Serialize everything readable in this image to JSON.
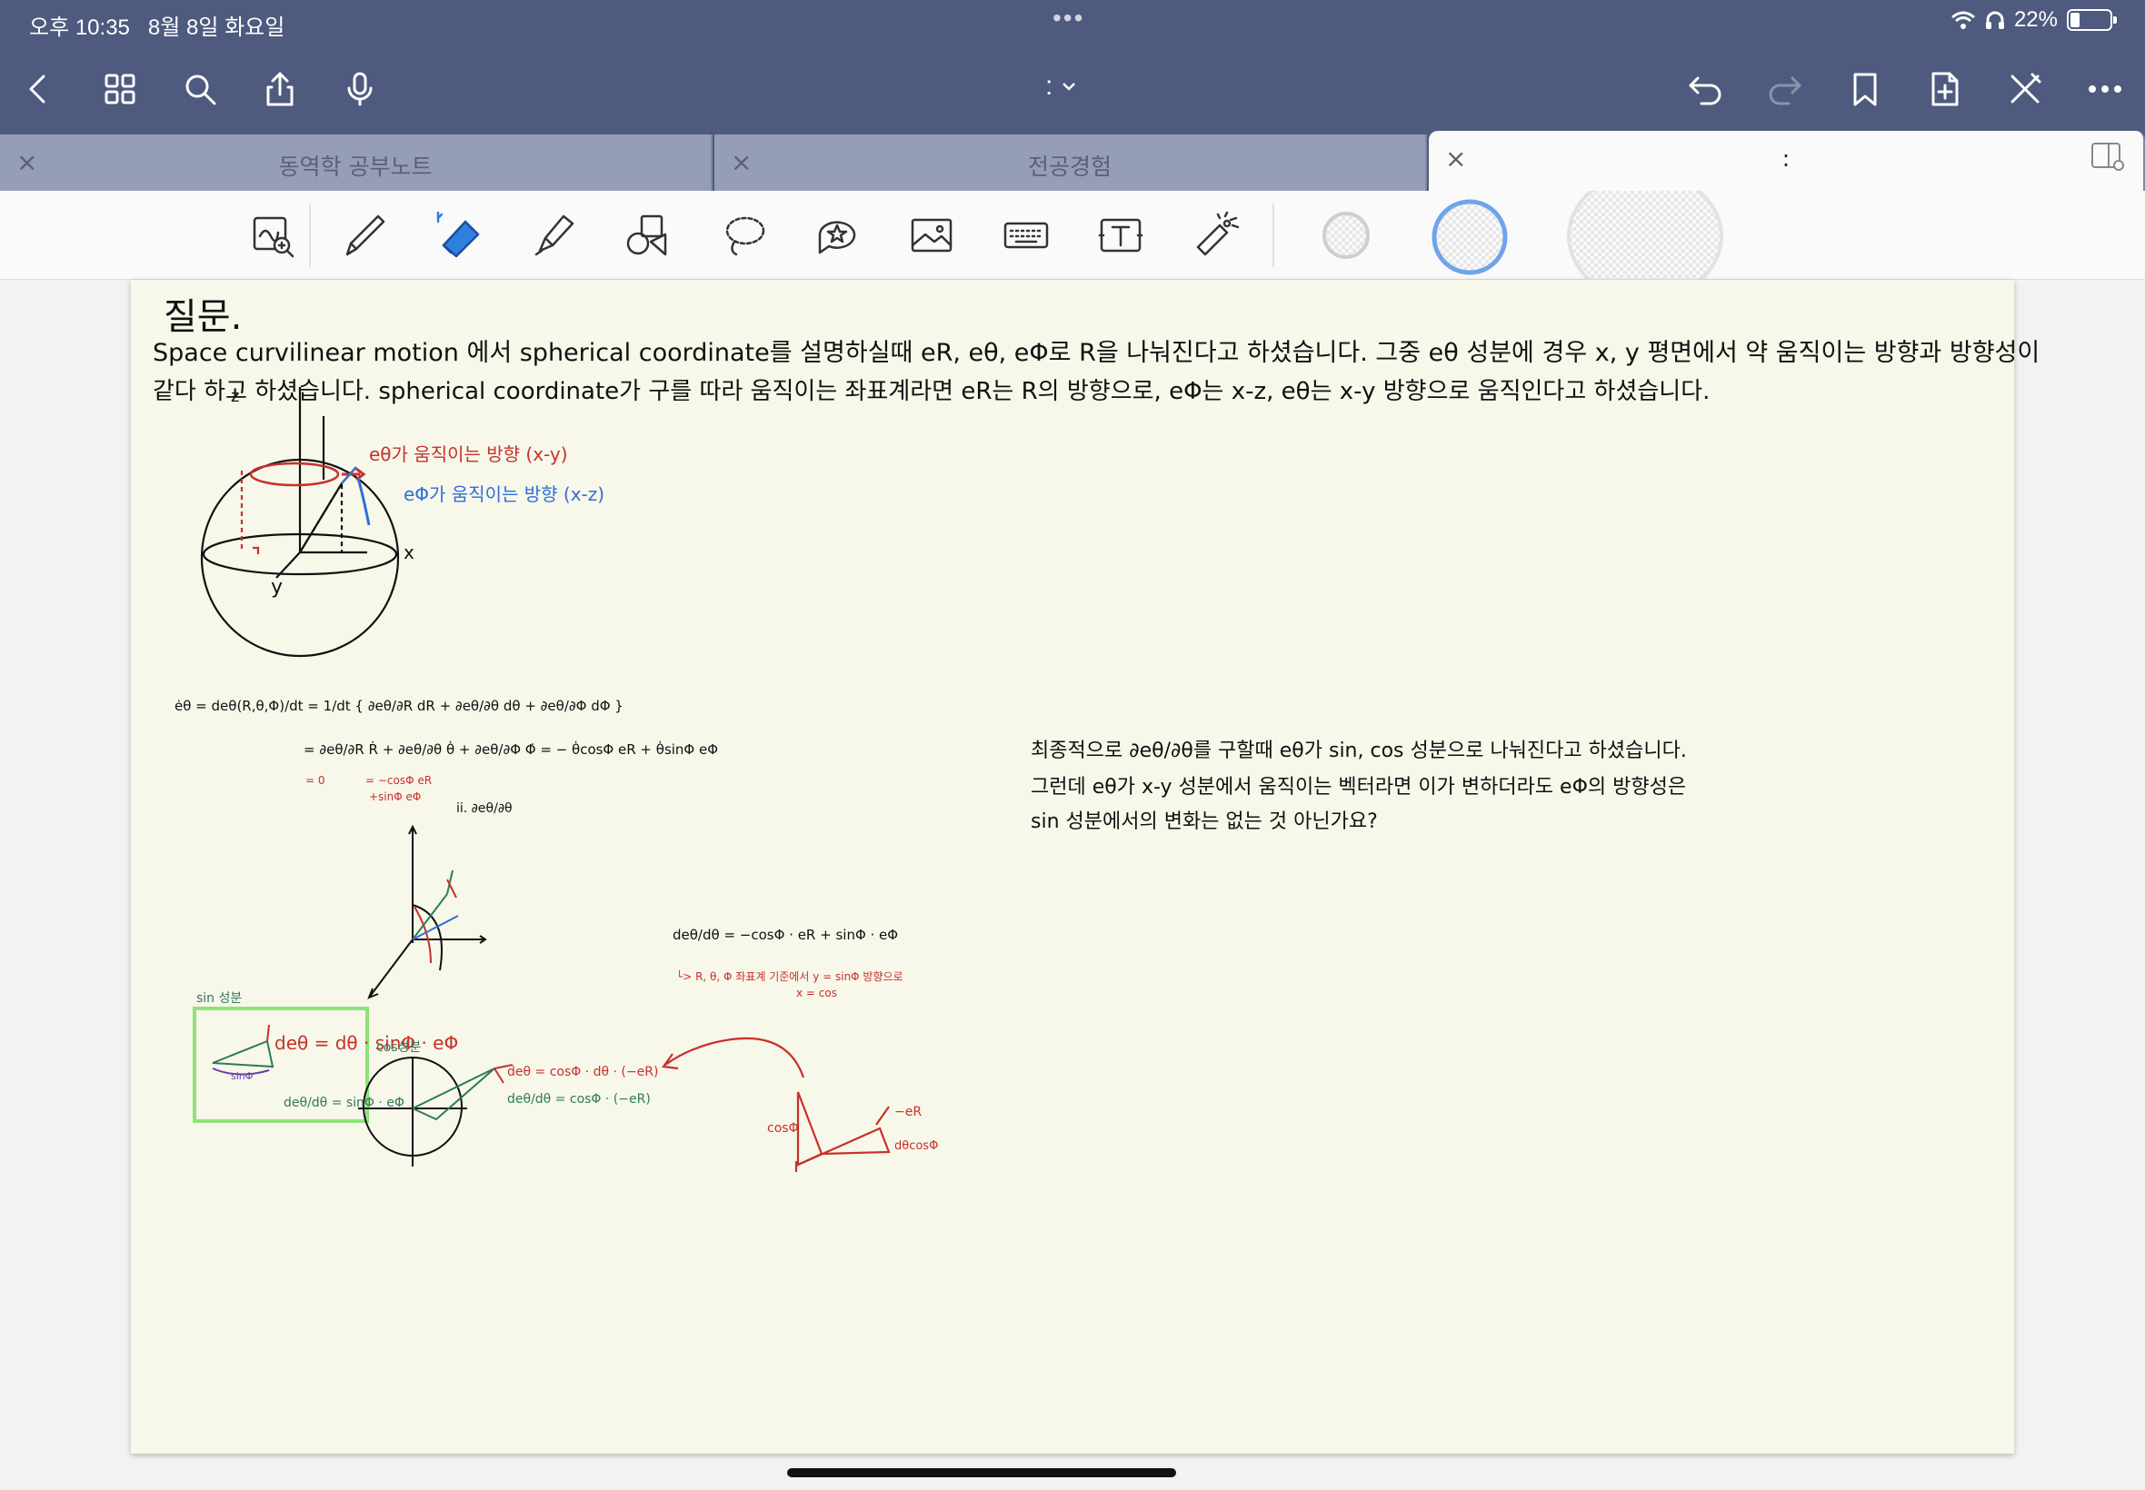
{
  "status_bar": {
    "time": "오후 10:35",
    "date": "8월 8일 화요일",
    "battery": "22%"
  },
  "nav": {
    "doc_title": ":"
  },
  "tabs": [
    {
      "label": "동역학 공부노트"
    },
    {
      "label": "전공경험"
    },
    {
      "label": ":"
    }
  ],
  "toolbar_tools": [
    "zoom-box-icon",
    "pen-icon",
    "eraser-icon",
    "highlighter-icon",
    "shapes-icon",
    "lasso-icon",
    "elements-icon",
    "image-icon",
    "keyboard-icon",
    "text-box-icon",
    "laser-pointer-icon"
  ],
  "colors": {
    "chrome": "#4e5a7e",
    "tab_inactive": "#969db7",
    "paper": "#f7f7ea",
    "ink_red": "#c8312a",
    "ink_blue": "#2f6fd6",
    "ink_green": "#2e7a5a",
    "highlight_box": "#8fe37a"
  },
  "note": {
    "title": "질문.",
    "line1": "Space  curvilinear motion 에서 spherical coordinate를 설명하실때 eR, eθ, eΦ로 R을 나눠진다고 하셨습니다. 그중 eθ 성분에 경우 x, y 평면에서 약 움직이는 방향과 방향성이",
    "line2": "같다 하고 하셨습니다. spherical coordinate가 구를 따라 움직이는 좌표계라면 eR는 R의 방향으로, eΦ는 x-z, eθ는 x-y 방향으로 움직인다고 하셨습니다.",
    "red_label": "eθ가 움직이는 방향 (x-y)",
    "blue_label": "eΦ가 움직이는 방향 (x-z)",
    "axis_z": "z",
    "axis_x": "x",
    "axis_y": "y",
    "eq1": "ėθ = deθ(R,θ,Φ)/dt = 1/dt { ∂eθ/∂R dR + ∂eθ/∂θ dθ + ∂eθ/∂Φ dΦ }",
    "eq2": "= ∂eθ/∂R Ṙ + ∂eθ/∂θ θ̇ + ∂eθ/∂Φ Φ̇ = − θ̇cosΦ eR + θ̇sinΦ eΦ",
    "eq2_note_a": "= 0",
    "eq2_note_b": "= −cosΦ eR",
    "eq2_note_c": "+sinΦ eΦ",
    "eq_ii": "ii. ∂eθ/∂θ",
    "eq3": "deθ/dθ = −cosΦ · eR + sinΦ · eΦ",
    "eq3_note": "└> R, θ, Φ 좌표계 기준에서 y = sinΦ 방향으로",
    "eq3_note2": "x = cos",
    "sin_label": "sin 성분",
    "cos_label": "cos성분",
    "sin_eq1": "deθ = dθ · sinΦ · eΦ",
    "sin_eq2": "deθ/dθ = sinΦ · eΦ",
    "sin_phi": "sinΦ",
    "cos_eq1": "deθ = cosΦ · dθ · (−eR)",
    "cos_eq2": "deθ/dθ = cosΦ · (−eR)",
    "cos_phi_label": "cosΦ",
    "dθ_cosΦ": "dθcosΦ",
    "minus_eR": "−eR",
    "question1": "최종적으로 ∂eθ/∂θ를 구할때  eθ가 sin, cos 성분으로 나눠진다고 하셨습니다.",
    "question2": "그런데 eθ가 x-y 성분에서 움직이는 벡터라면 이가 변하더라도 eΦ의 방향성은",
    "question3": "sin 성분에서의 변화는 없는 것 아닌가요?"
  }
}
